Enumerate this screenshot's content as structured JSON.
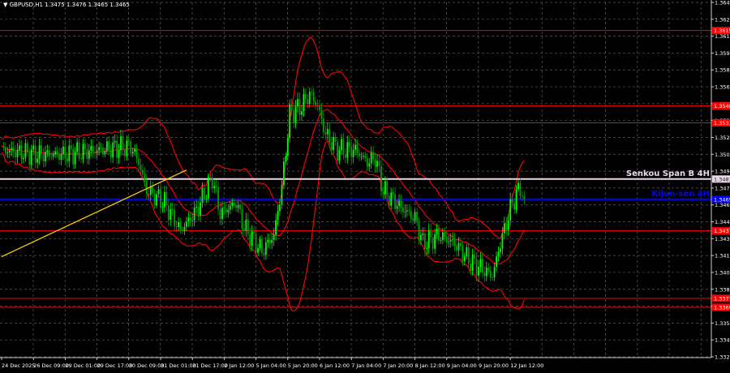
{
  "header": {
    "symbol": "GBPUSD,H1",
    "ohlc": "1.3475 1.3476 1.3465 1.3465"
  },
  "chart_data": {
    "type": "candlestick",
    "symbol": "GBPUSD",
    "timeframe": "H1",
    "ylim": [
      1.3325,
      1.364
    ],
    "y_ticks": [
      "1.3640",
      "1.3625",
      "1.3610",
      "1.3595",
      "1.3580",
      "1.3565",
      "1.3550",
      "1.3535",
      "1.3520",
      "1.3505",
      "1.3490",
      "1.3475",
      "1.3460",
      "1.3445",
      "1.3430",
      "1.3415",
      "1.3400",
      "1.3385",
      "1.3370",
      "1.3355",
      "1.3340",
      "1.3325"
    ],
    "x_ticks": [
      {
        "bar": 0,
        "label": "24 Dec 2025"
      },
      {
        "bar": 16,
        "label": "26 Dec 09:00"
      },
      {
        "bar": 32,
        "label": "29 Dec 01:00"
      },
      {
        "bar": 48,
        "label": "29 Dec 17:00"
      },
      {
        "bar": 64,
        "label": "30 Dec 09:00"
      },
      {
        "bar": 80,
        "label": "31 Dec 01:00"
      },
      {
        "bar": 96,
        "label": "31 Dec 17:00"
      },
      {
        "bar": 112,
        "label": "2 Jan 12:00"
      },
      {
        "bar": 128,
        "label": "5 Jan 04:00"
      },
      {
        "bar": 144,
        "label": "5 Jan 20:00"
      },
      {
        "bar": 160,
        "label": "6 Jan 12:00"
      },
      {
        "bar": 176,
        "label": "7 Jan 04:00"
      },
      {
        "bar": 192,
        "label": "7 Jan 20:00"
      },
      {
        "bar": 208,
        "label": "8 Jan 12:00"
      },
      {
        "bar": 224,
        "label": "9 Jan 04:00"
      },
      {
        "bar": 240,
        "label": "9 Jan 20:00"
      },
      {
        "bar": 256,
        "label": "12 Jan 12:00"
      }
    ],
    "total_bars": 263,
    "price_path": [
      [
        0,
        1.3509
      ],
      [
        16,
        1.3505
      ],
      [
        32,
        1.3505
      ],
      [
        49,
        1.3509
      ],
      [
        65,
        1.3512
      ],
      [
        69,
        1.3498
      ],
      [
        73,
        1.3473
      ],
      [
        82,
        1.3462
      ],
      [
        90,
        1.3437
      ],
      [
        98,
        1.3455
      ],
      [
        106,
        1.3484
      ],
      [
        110,
        1.3452
      ],
      [
        118,
        1.3462
      ],
      [
        122,
        1.344
      ],
      [
        131,
        1.3419
      ],
      [
        137,
        1.3433
      ],
      [
        141,
        1.3476
      ],
      [
        145,
        1.3541
      ],
      [
        151,
        1.3548
      ],
      [
        155,
        1.3559
      ],
      [
        159,
        1.3548
      ],
      [
        163,
        1.3523
      ],
      [
        169,
        1.3509
      ],
      [
        178,
        1.3509
      ],
      [
        184,
        1.3498
      ],
      [
        188,
        1.3502
      ],
      [
        192,
        1.3473
      ],
      [
        200,
        1.3459
      ],
      [
        208,
        1.3448
      ],
      [
        212,
        1.3426
      ],
      [
        220,
        1.3433
      ],
      [
        228,
        1.3426
      ],
      [
        235,
        1.3411
      ],
      [
        241,
        1.3404
      ],
      [
        247,
        1.3397
      ],
      [
        251,
        1.3426
      ],
      [
        257,
        1.3462
      ],
      [
        261,
        1.3476
      ],
      [
        263,
        1.3465
      ]
    ],
    "levels": [
      {
        "price": 1.3615,
        "label": "1.3615",
        "color": "#ff0000"
      },
      {
        "price": 1.3548,
        "label": "1.3548",
        "color": "#ff0000"
      },
      {
        "price": 1.3533,
        "label": "1.3533",
        "color": "#ff0000"
      },
      {
        "price": 1.3483,
        "label": "1.3483",
        "color": "#e8d8e8",
        "name": "Senkou Span B 4H"
      },
      {
        "price": 1.3465,
        "label": "1.3465",
        "color": "#0000ff",
        "name": "Kijun-sen 4H"
      },
      {
        "price": 1.3437,
        "label": "1.3437",
        "color": "#ff0000"
      },
      {
        "price": 1.3377,
        "label": "1.3377",
        "color": "#ff0000"
      },
      {
        "price": 1.3369,
        "label": "1.3369",
        "color": "#ff0000"
      }
    ],
    "trendline": {
      "from": [
        0,
        1.3414
      ],
      "to": [
        93,
        1.3491
      ],
      "color": "#ffcc00"
    },
    "bollinger": {
      "period": 20,
      "deviations": 2,
      "color": "#ff0000"
    },
    "colors": {
      "bull": "#00ff00",
      "bear": "#00a000",
      "grid": "#5a5a5a",
      "background": "#000000"
    }
  }
}
